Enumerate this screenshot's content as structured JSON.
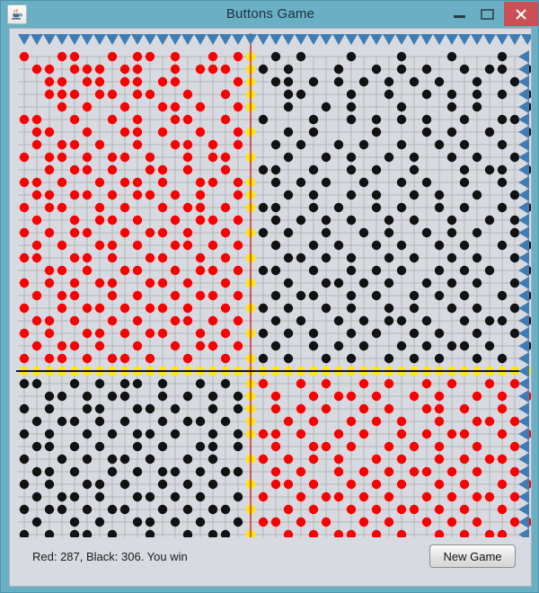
{
  "window": {
    "title": "Buttons Game",
    "icon": "java-coffee-cup-icon",
    "controls": {
      "minimize": "minimize-icon",
      "maximize": "maximize-icon",
      "close": "close-icon"
    },
    "colors": {
      "titlebar": "#6aafc4",
      "close_button": "#cb5055",
      "client_background": "#d7dae1"
    }
  },
  "status": {
    "text": "Red: 287, Black: 306. You win",
    "red_score": 287,
    "black_score": 306,
    "result": "You win"
  },
  "toolbar": {
    "new_game_label": "New Game"
  },
  "board": {
    "columns": 41,
    "rows": 40,
    "cell_size": 14,
    "colors": {
      "grid_line": "#b4b4b4",
      "red_dot": "#fa0000",
      "black_dot": "#121212",
      "yellow_dot": "#ffe800",
      "vertical_divider": "#d22222",
      "horizontal_divider": "#101038",
      "triangle": "#3d7cb5"
    },
    "dividers": {
      "vertical_col": 18,
      "horizontal_row": 25
    },
    "quadrants": {
      "top_left": "red",
      "top_right": "black",
      "bottom_left": "black",
      "bottom_right": "red"
    },
    "grid": [
      "1001100101101001010010100010001000100010001",
      "0110111011001011101101000100101010010110110",
      "0011011011011000010011010101010101001001000",
      "0011101101100100101001100010010010101010100",
      "0001010010011010010001001010001000101000110",
      "1100100101001100100100010010101010010011010",
      "0110010011010010011001010000100010100100101",
      "0101101001001101010010100101001001010010010",
      "1011010110100101101001001010010100101001001",
      "0010110100110100100110010010100100010110100",
      "1101001011010011010010101001001010010010010",
      "0110110101101010011001010010100101001001010",
      "1011001010010110100110010100101001010010100",
      "0100101101001011010010101010010100100101001",
      "1010110010110100101101001001010010101001010",
      "0101001101001101010010010100101001010010101",
      "1100110100110010101001101010010100101001010",
      "0011010011001011010110010010101001010100101",
      "1010101100110100101001001101010010101001001",
      "0101100101001011010010110010100101010010110",
      "1001011010110100101101001010010100101001010",
      "0110100101001101010010100101011010010110100",
      "1010011010110010101101010010100101001001011",
      "0101101001001011010010010101001010110100100",
      "1011010110100100101101001010010101001010010",
      "2222222222222222222222222222222222222222222",
      "1100101011010010100100101001010010100101001",
      "0011010110010101011010010110100101001010110",
      "1010011001101001010010101001010011010010010",
      "0101101010010110101001010010101001001101001",
      "1010010101101001010110100101001010110010100",
      "0110101001010011010010011010010101001001011",
      "1001010110100101001101010100101001010110010",
      "0110100101011010110010100101010110101001001",
      "1010011010010101001011010010101001010010110",
      "0101101001101010010100101101010010101101001",
      "1011010110010101101001010010101101010010010",
      "0100101001101010010110101001010010101001101",
      "1010110100100101101001010110101001010110010",
      "0101001011010110010101101001010110101001010"
    ]
  }
}
